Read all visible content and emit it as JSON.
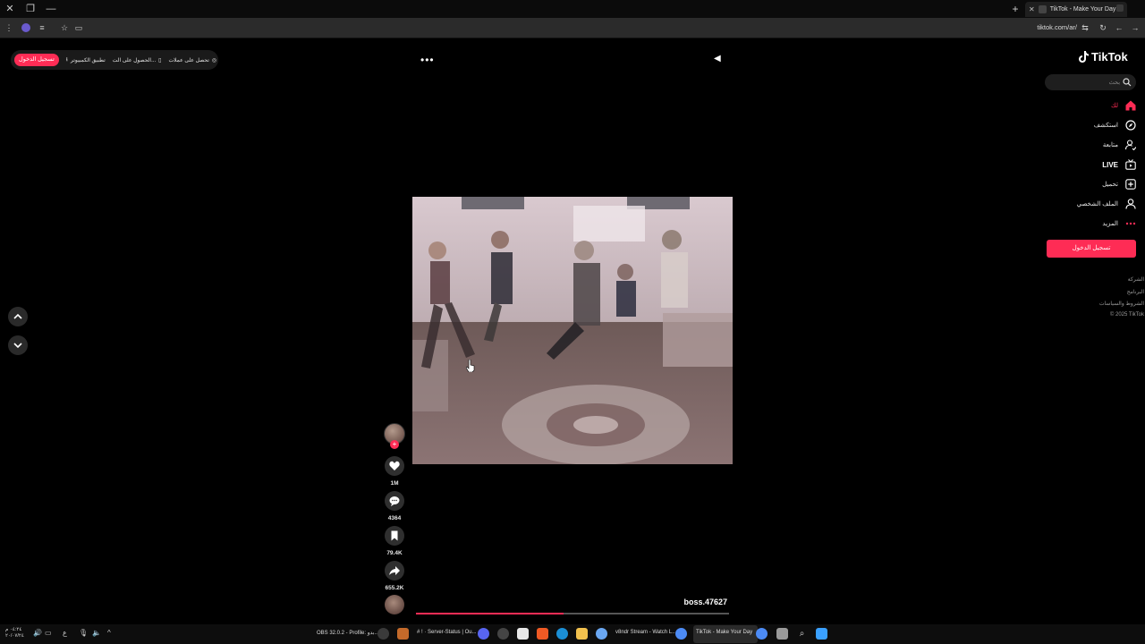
{
  "browser": {
    "tab_title": "TikTok - Make Your Day",
    "url": "tiktok.com/ar/"
  },
  "promo_bar": {
    "login": "تسجيل الدخول",
    "desktop_app": "تطبيق الكمبيوتر",
    "get_app": "الحصول على الت...",
    "coins": "تحصل على عملات"
  },
  "sidebar": {
    "logo": "TikTok",
    "search_placeholder": "بحث",
    "items": [
      {
        "label": "لك",
        "icon": "home-icon",
        "active": true
      },
      {
        "label": "استكشف",
        "icon": "compass-icon"
      },
      {
        "label": "متابعة",
        "icon": "following-icon"
      },
      {
        "label": "LIVE",
        "icon": "live-icon"
      },
      {
        "label": "تحميل",
        "icon": "upload-icon"
      },
      {
        "label": "الملف الشخصي",
        "icon": "profile-icon"
      },
      {
        "label": "المزيد",
        "icon": "more-icon"
      }
    ],
    "login_button": "تسجيل الدخول",
    "footer": [
      "الشركة",
      "البرنامج",
      "الشروط والسياسات",
      "© 2025 TikTok"
    ]
  },
  "video": {
    "username": "boss.47627",
    "progress": 0.47,
    "likes": "1M",
    "comments": "4364",
    "saves": "79.4K",
    "shares": "655.2K"
  },
  "taskbar": {
    "time": "٠٤:٢٤ م",
    "date": "٢٠/٠٧/٢٤",
    "obs": "OBS 32.0.2 - Profile: بدو...",
    "discord": "# ! · Server-Status | Ou...",
    "stream": "v8ndr Stream - Watch L...",
    "tiktok": "TikTok - Make Your Day"
  },
  "colors": {
    "accent": "#fe2c55",
    "background": "#000000"
  }
}
